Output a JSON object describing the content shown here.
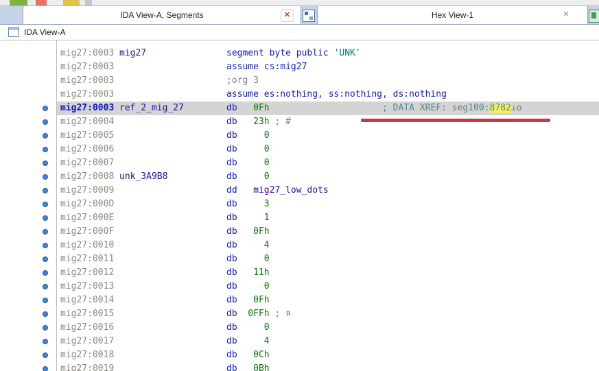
{
  "tabs": {
    "ida_view": {
      "label": "IDA View-A, Segments"
    },
    "hex_view": {
      "label": "Hex View-1"
    }
  },
  "icons": {
    "close_glyph": "✕"
  },
  "view_title": "IDA View-A",
  "colors": {
    "keyword": "#0d1dc0",
    "number": "#007a00",
    "name": "#2a0ba0",
    "string": "#007878",
    "comment": "#7d7d7d",
    "xref": "#4e8b8b",
    "xref_highlight_bg": "#f3ef69",
    "address": "#8c8880",
    "current_address": "#0a18c8",
    "current_line_bg": "#d4d4d4",
    "annotation_red": "#c23b44",
    "dot_blue": "#3d85d8",
    "tabbar_bg": "#c6d2e6"
  },
  "listing": {
    "lines": [
      {
        "addr": "mig27:0003",
        "name": "mig27",
        "dot": false,
        "hl": false,
        "body": [
          {
            "t": "segment byte public ",
            "c": "kw"
          },
          {
            "t": "'UNK'",
            "c": "str"
          }
        ]
      },
      {
        "addr": "mig27:0003",
        "name": "",
        "dot": false,
        "hl": false,
        "body": [
          {
            "t": "assume cs:mig27",
            "c": "kw"
          }
        ]
      },
      {
        "addr": "mig27:0003",
        "name": "",
        "dot": false,
        "hl": false,
        "body": [
          {
            "t": ";org 3",
            "c": "cmt"
          }
        ]
      },
      {
        "addr": "mig27:0003",
        "name": "",
        "dot": false,
        "hl": false,
        "body": [
          {
            "t": "assume es:nothing, ss:nothing, ds:nothing",
            "c": "kw"
          }
        ]
      },
      {
        "addr": "mig27:0003",
        "name": "ref_2_mig_27",
        "dot": true,
        "hl": true,
        "body": [
          {
            "t": "db",
            "c": "kw"
          },
          {
            "t": "   0Fh",
            "c": "num"
          },
          {
            "t": "                     ",
            "c": "plain"
          },
          {
            "t": "; DATA XREF: seg100:",
            "c": "xref"
          },
          {
            "t": "8782",
            "c": "xrefhl"
          },
          {
            "t": "↓o",
            "c": "cmt"
          }
        ]
      },
      {
        "addr": "mig27:0004",
        "name": "",
        "dot": true,
        "hl": false,
        "body": [
          {
            "t": "db",
            "c": "kw"
          },
          {
            "t": "   23h",
            "c": "num"
          },
          {
            "t": " ",
            "c": "plain"
          },
          {
            "t": "; #",
            "c": "cmt"
          }
        ]
      },
      {
        "addr": "mig27:0005",
        "name": "",
        "dot": true,
        "hl": false,
        "body": [
          {
            "t": "db",
            "c": "kw"
          },
          {
            "t": "     0",
            "c": "num"
          }
        ]
      },
      {
        "addr": "mig27:0006",
        "name": "",
        "dot": true,
        "hl": false,
        "body": [
          {
            "t": "db",
            "c": "kw"
          },
          {
            "t": "     0",
            "c": "num"
          }
        ]
      },
      {
        "addr": "mig27:0007",
        "name": "",
        "dot": true,
        "hl": false,
        "body": [
          {
            "t": "db",
            "c": "kw"
          },
          {
            "t": "     0",
            "c": "num"
          }
        ]
      },
      {
        "addr": "mig27:0008",
        "name": "unk_3A9B8",
        "dot": true,
        "hl": false,
        "body": [
          {
            "t": "db",
            "c": "kw"
          },
          {
            "t": "     0",
            "c": "num"
          }
        ]
      },
      {
        "addr": "mig27:0009",
        "name": "",
        "dot": true,
        "hl": false,
        "body": [
          {
            "t": "dd",
            "c": "kw"
          },
          {
            "t": "   ",
            "c": "plain"
          },
          {
            "t": "mig27_low_dots",
            "c": "name"
          }
        ]
      },
      {
        "addr": "mig27:000D",
        "name": "",
        "dot": true,
        "hl": false,
        "body": [
          {
            "t": "db",
            "c": "kw"
          },
          {
            "t": "     3",
            "c": "num"
          }
        ]
      },
      {
        "addr": "mig27:000E",
        "name": "",
        "dot": true,
        "hl": false,
        "body": [
          {
            "t": "db",
            "c": "kw"
          },
          {
            "t": "     1",
            "c": "num"
          }
        ]
      },
      {
        "addr": "mig27:000F",
        "name": "",
        "dot": true,
        "hl": false,
        "body": [
          {
            "t": "db",
            "c": "kw"
          },
          {
            "t": "   0Fh",
            "c": "num"
          }
        ]
      },
      {
        "addr": "mig27:0010",
        "name": "",
        "dot": true,
        "hl": false,
        "body": [
          {
            "t": "db",
            "c": "kw"
          },
          {
            "t": "     4",
            "c": "num"
          }
        ]
      },
      {
        "addr": "mig27:0011",
        "name": "",
        "dot": true,
        "hl": false,
        "body": [
          {
            "t": "db",
            "c": "kw"
          },
          {
            "t": "     0",
            "c": "num"
          }
        ]
      },
      {
        "addr": "mig27:0012",
        "name": "",
        "dot": true,
        "hl": false,
        "body": [
          {
            "t": "db",
            "c": "kw"
          },
          {
            "t": "   11h",
            "c": "num"
          }
        ]
      },
      {
        "addr": "mig27:0013",
        "name": "",
        "dot": true,
        "hl": false,
        "body": [
          {
            "t": "db",
            "c": "kw"
          },
          {
            "t": "     0",
            "c": "num"
          }
        ]
      },
      {
        "addr": "mig27:0014",
        "name": "",
        "dot": true,
        "hl": false,
        "body": [
          {
            "t": "db",
            "c": "kw"
          },
          {
            "t": "   0Fh",
            "c": "num"
          }
        ]
      },
      {
        "addr": "mig27:0015",
        "name": "",
        "dot": true,
        "hl": false,
        "body": [
          {
            "t": "db",
            "c": "kw"
          },
          {
            "t": "  0FFh",
            "c": "num"
          },
          {
            "t": " ",
            "c": "plain"
          },
          {
            "t": "; я",
            "c": "cmt"
          }
        ]
      },
      {
        "addr": "mig27:0016",
        "name": "",
        "dot": true,
        "hl": false,
        "body": [
          {
            "t": "db",
            "c": "kw"
          },
          {
            "t": "     0",
            "c": "num"
          }
        ]
      },
      {
        "addr": "mig27:0017",
        "name": "",
        "dot": true,
        "hl": false,
        "body": [
          {
            "t": "db",
            "c": "kw"
          },
          {
            "t": "     4",
            "c": "num"
          }
        ]
      },
      {
        "addr": "mig27:0018",
        "name": "",
        "dot": true,
        "hl": false,
        "body": [
          {
            "t": "db",
            "c": "kw"
          },
          {
            "t": "   0Ch",
            "c": "num"
          }
        ]
      },
      {
        "addr": "mig27:0019",
        "name": "",
        "dot": true,
        "hl": false,
        "body": [
          {
            "t": "db",
            "c": "kw"
          },
          {
            "t": "   0Bh",
            "c": "num"
          }
        ]
      }
    ]
  }
}
